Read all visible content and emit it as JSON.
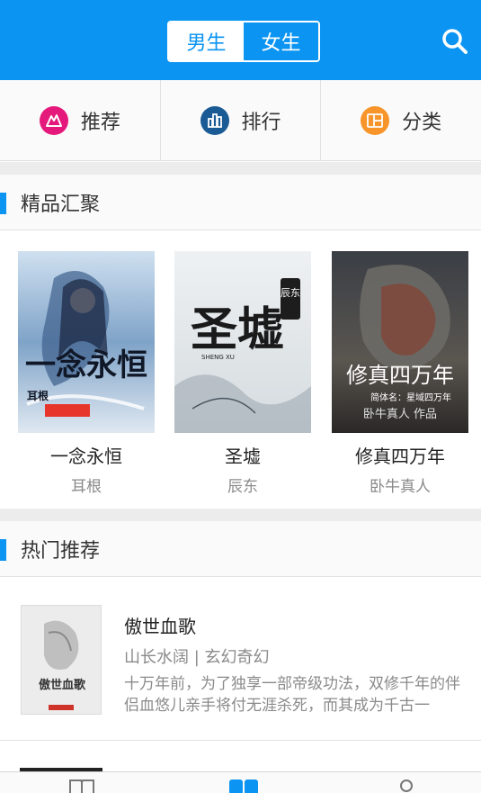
{
  "header": {
    "gender_tabs": [
      {
        "label": "男生",
        "active": true
      },
      {
        "label": "女生",
        "active": false
      }
    ],
    "search_icon": "search-icon"
  },
  "quick_nav": [
    {
      "label": "推荐",
      "icon": "recommend-icon",
      "color": "#e5187b"
    },
    {
      "label": "排行",
      "icon": "ranking-icon",
      "color": "#1a5b95"
    },
    {
      "label": "分类",
      "icon": "category-icon",
      "color": "#f7952a"
    }
  ],
  "featured": {
    "title": "精品汇聚",
    "books": [
      {
        "title": "一念永恒",
        "author": "耳根",
        "cover_text": "一念永恒",
        "cover_sub": "耳根"
      },
      {
        "title": "圣墟",
        "author": "辰东",
        "cover_text": "圣墟",
        "cover_sub": "辰东",
        "cover_pinyin": "SHENG XU"
      },
      {
        "title": "修真四万年",
        "author": "卧牛真人",
        "cover_text": "修真四万年",
        "cover_sub": "简体名：星域四万年",
        "cover_sub2": "卧牛真人 作品"
      }
    ]
  },
  "hot": {
    "title": "热门推荐",
    "items": [
      {
        "title": "傲世血歌",
        "meta": "山长水阔 | 玄幻奇幻",
        "desc": "十万年前，为了独享一部帝级功法，双修千年的伴侣血悠儿亲手将付无涯杀死，而其成为千古一",
        "cover_text": "傲世血歌"
      }
    ]
  },
  "tabbar": {
    "tabs": [
      {
        "icon": "bookshelf-icon"
      },
      {
        "icon": "bookstore-icon",
        "active": true
      },
      {
        "icon": "profile-icon"
      }
    ]
  },
  "colors": {
    "primary": "#0b94f2",
    "recommend": "#e5187b",
    "ranking": "#1a5b95",
    "category": "#f7952a"
  }
}
